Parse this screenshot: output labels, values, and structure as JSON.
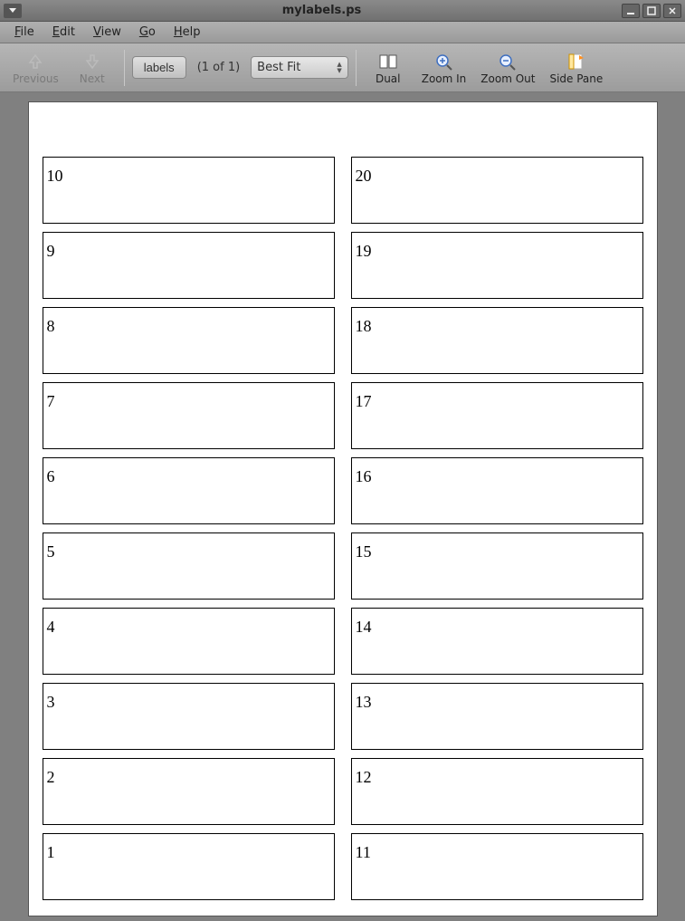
{
  "window": {
    "title": "mylabels.ps"
  },
  "menu": {
    "file": "File",
    "edit": "Edit",
    "view": "View",
    "go": "Go",
    "help": "Help"
  },
  "toolbar": {
    "previous": "Previous",
    "next": "Next",
    "labels_button": "labels",
    "page_indicator": "(1 of 1)",
    "zoom_select": "Best Fit",
    "dual": "Dual",
    "zoom_in": "Zoom In",
    "zoom_out": "Zoom Out",
    "side_pane": "Side Pane"
  },
  "document": {
    "left_column": [
      "10",
      "9",
      "8",
      "7",
      "6",
      "5",
      "4",
      "3",
      "2",
      "1"
    ],
    "right_column": [
      "20",
      "19",
      "18",
      "17",
      "16",
      "15",
      "14",
      "13",
      "12",
      "11"
    ]
  }
}
